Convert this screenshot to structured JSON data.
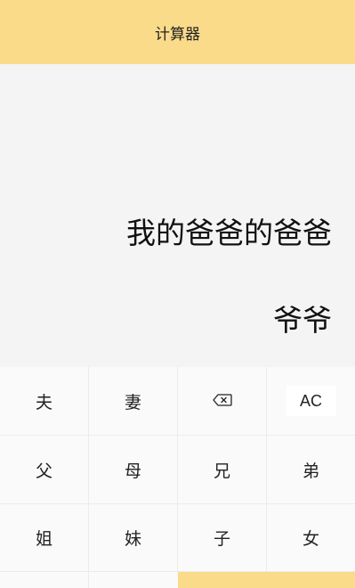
{
  "header": {
    "title": "计算器"
  },
  "display": {
    "expression": "我的爸爸的爸爸",
    "result": "爷爷"
  },
  "keypad": {
    "rows": [
      [
        {
          "label": "夫",
          "name": "key-husband"
        },
        {
          "label": "妻",
          "name": "key-wife"
        },
        {
          "label": "",
          "name": "backspace-key",
          "icon": "backspace-icon"
        },
        {
          "label": "AC",
          "name": "clear-all-button"
        }
      ],
      [
        {
          "label": "父",
          "name": "key-father"
        },
        {
          "label": "母",
          "name": "key-mother"
        },
        {
          "label": "兄",
          "name": "key-elder-brother"
        },
        {
          "label": "弟",
          "name": "key-younger-brother"
        }
      ],
      [
        {
          "label": "姐",
          "name": "key-elder-sister"
        },
        {
          "label": "妹",
          "name": "key-younger-sister"
        },
        {
          "label": "子",
          "name": "key-son"
        },
        {
          "label": "女",
          "name": "key-daughter"
        }
      ]
    ]
  },
  "colors": {
    "accent": "#fadb8a",
    "display_bg": "#f4f4f4",
    "key_bg": "#fafafa"
  }
}
